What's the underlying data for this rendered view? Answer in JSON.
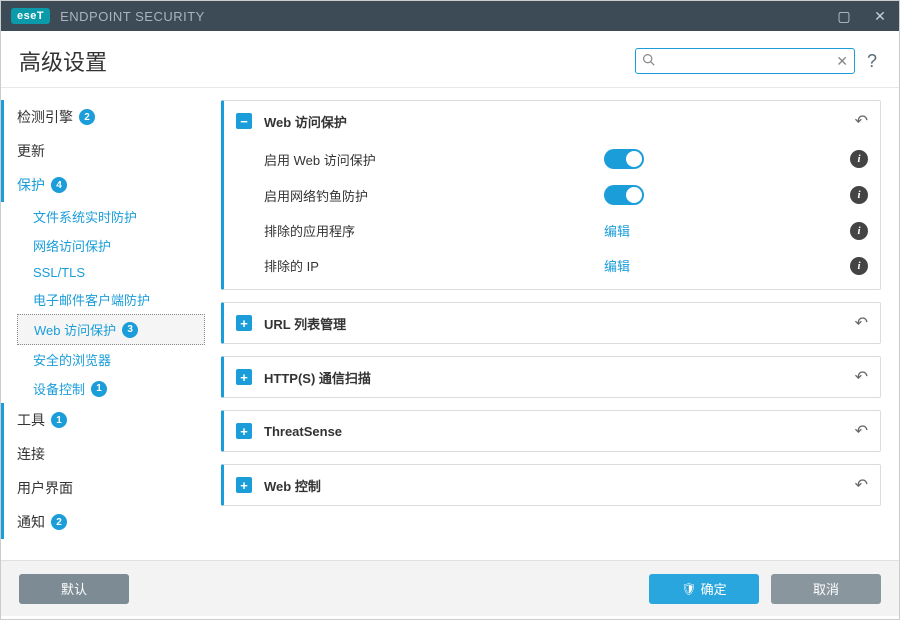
{
  "app": {
    "brand_badge": "eseT",
    "brand_text": "ENDPOINT SECURITY"
  },
  "header": {
    "title": "高级设置",
    "search_placeholder": "",
    "help": "?"
  },
  "sidebar": {
    "detection": {
      "label": "检测引擎",
      "badge": "2"
    },
    "update": {
      "label": "更新"
    },
    "protection": {
      "label": "保护",
      "badge": "4",
      "children": {
        "filesystem": {
          "label": "文件系统实时防护"
        },
        "network": {
          "label": "网络访问保护"
        },
        "ssltls": {
          "label": "SSL/TLS"
        },
        "email": {
          "label": "电子邮件客户端防护"
        },
        "web": {
          "label": "Web 访问保护",
          "badge": "3"
        },
        "browser": {
          "label": "安全的浏览器"
        },
        "device": {
          "label": "设备控制",
          "badge": "1"
        }
      }
    },
    "tools": {
      "label": "工具",
      "badge": "1"
    },
    "connect": {
      "label": "连接"
    },
    "ui": {
      "label": "用户界面"
    },
    "notify": {
      "label": "通知",
      "badge": "2"
    }
  },
  "panels": {
    "web_protect": {
      "title": "Web 访问保护",
      "rows": {
        "enable_web": {
          "label": "启用 Web 访问保护"
        },
        "enable_phish": {
          "label": "启用网络钓鱼防护"
        },
        "excl_apps": {
          "label": "排除的应用程序",
          "action": "编辑"
        },
        "excl_ip": {
          "label": "排除的 IP",
          "action": "编辑"
        }
      }
    },
    "url_list": {
      "title": "URL 列表管理"
    },
    "https_scan": {
      "title": "HTTP(S) 通信扫描"
    },
    "threatsense": {
      "title": "ThreatSense"
    },
    "web_control": {
      "title": "Web 控制"
    }
  },
  "footer": {
    "default": "默认",
    "ok": "确定",
    "cancel": "取消"
  }
}
